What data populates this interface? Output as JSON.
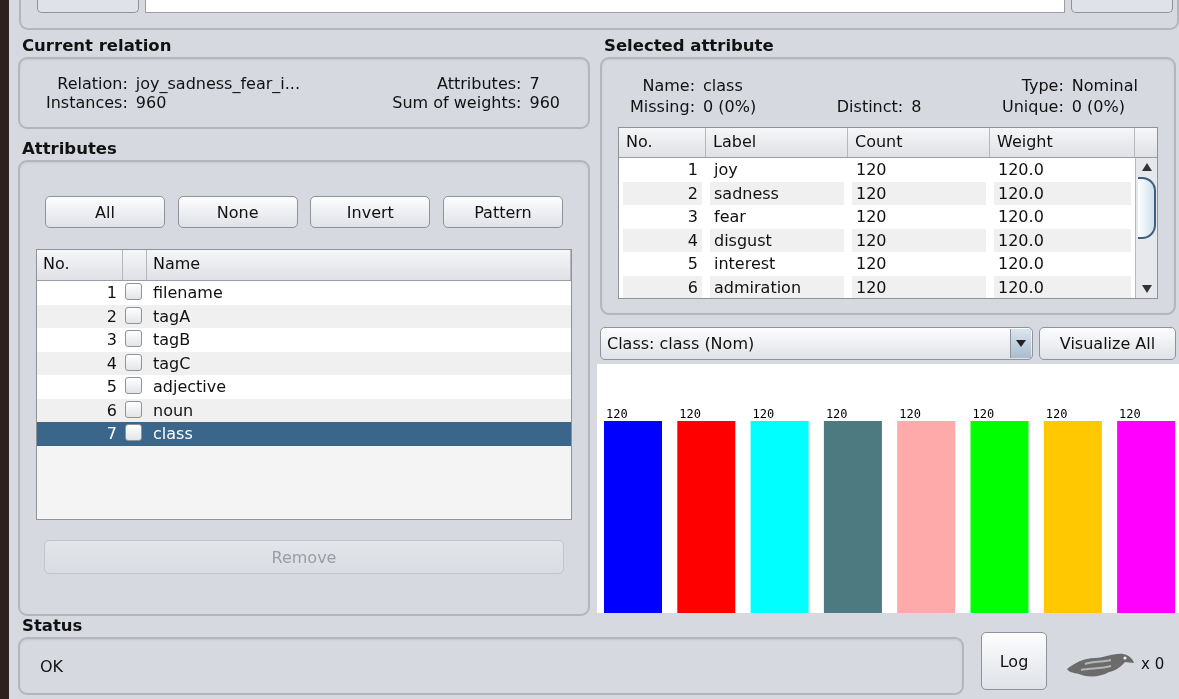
{
  "current_relation": {
    "title": "Current relation",
    "fields": [
      {
        "label": "Relation:",
        "value": "joy_sadness_fear_i..."
      },
      {
        "label": "Attributes:",
        "value": "7"
      },
      {
        "label": "Instances:",
        "value": "960"
      },
      {
        "label": "Sum of weights:",
        "value": "960"
      }
    ]
  },
  "attributes": {
    "title": "Attributes",
    "buttons": [
      "All",
      "None",
      "Invert",
      "Pattern"
    ],
    "columns": [
      "No.",
      "Name"
    ],
    "rows": [
      {
        "no": "1",
        "checked": false,
        "name": "filename",
        "selected": false
      },
      {
        "no": "2",
        "checked": false,
        "name": "tagA",
        "selected": false
      },
      {
        "no": "3",
        "checked": false,
        "name": "tagB",
        "selected": false
      },
      {
        "no": "4",
        "checked": false,
        "name": "tagC",
        "selected": false
      },
      {
        "no": "5",
        "checked": false,
        "name": "adjective",
        "selected": false
      },
      {
        "no": "6",
        "checked": false,
        "name": "noun",
        "selected": false
      },
      {
        "no": "7",
        "checked": false,
        "name": "class",
        "selected": true
      }
    ],
    "remove_button": {
      "label": "Remove",
      "disabled": true
    }
  },
  "selected_attribute": {
    "title": "Selected attribute",
    "field_rows": [
      [
        {
          "label": "Name:",
          "value": "class"
        },
        {
          "label": "Type:",
          "value": "Nominal"
        }
      ],
      [
        {
          "label": "Missing:",
          "value": "0 (0%)"
        },
        {
          "label": "Distinct:",
          "value": "8"
        },
        {
          "label": "Unique:",
          "value": "0 (0%)"
        }
      ]
    ],
    "table": {
      "columns": [
        "No.",
        "Label",
        "Count",
        "Weight"
      ],
      "rows": [
        [
          "1",
          "joy",
          "120",
          "120.0"
        ],
        [
          "2",
          "sadness",
          "120",
          "120.0"
        ],
        [
          "3",
          "fear",
          "120",
          "120.0"
        ],
        [
          "4",
          "disgust",
          "120",
          "120.0"
        ],
        [
          "5",
          "interest",
          "120",
          "120.0"
        ],
        [
          "6",
          "admiration",
          "120",
          "120.0"
        ]
      ]
    }
  },
  "class_selector": {
    "value": "Class: class (Nom)"
  },
  "visualize_button": "Visualize All",
  "chart_data": {
    "type": "bar",
    "values": [
      120,
      120,
      120,
      120,
      120,
      120,
      120,
      120
    ],
    "colors": [
      "#0000ff",
      "#ff0000",
      "#00ffff",
      "#4d7a80",
      "#ffaaaa",
      "#00ff00",
      "#ffc800",
      "#ff00ff"
    ],
    "data_labels": true
  },
  "status": {
    "title": "Status",
    "message": "OK"
  },
  "log_button": "Log",
  "task_count": "x 0"
}
